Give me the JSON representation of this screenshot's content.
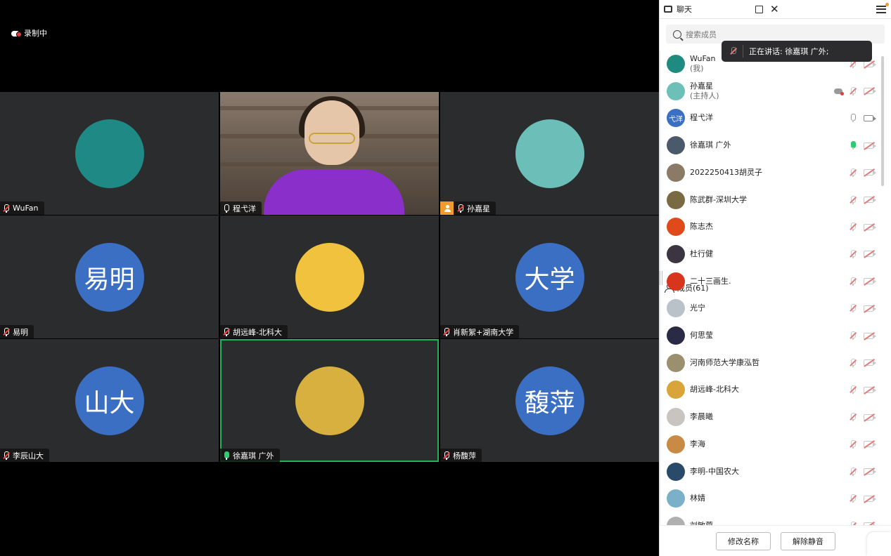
{
  "recording": {
    "label": "录制中"
  },
  "tiles": [
    {
      "name": "WuFan",
      "type": "image",
      "mic": "muted",
      "host": false
    },
    {
      "name": "程弋洋",
      "type": "video",
      "mic": "on",
      "host": false
    },
    {
      "name": "孙嘉星",
      "type": "image",
      "mic": "muted",
      "host": true
    },
    {
      "name": "易明",
      "type": "text",
      "avatar_text": "易明",
      "mic": "muted",
      "host": false
    },
    {
      "name": "胡远峰-北科大",
      "type": "image",
      "mic": "muted",
      "host": false
    },
    {
      "name": "肖新絮+湖南大学",
      "type": "text",
      "avatar_text": "大学",
      "mic": "muted",
      "host": false
    },
    {
      "name": "李辰山大",
      "type": "text",
      "avatar_text": "山大",
      "mic": "muted",
      "host": false
    },
    {
      "name": "徐嘉琪 广外",
      "type": "image",
      "mic": "speaking",
      "host": false,
      "speaking": true
    },
    {
      "name": "杨馥萍",
      "type": "text",
      "avatar_text": "馥萍",
      "mic": "muted",
      "host": false
    }
  ],
  "sidebar": {
    "tab_chat": "聊天",
    "tab_members": "成员(61)",
    "search_placeholder": "搜索成员",
    "speaking_tooltip": "正在讲话:  徐嘉琪 广外;",
    "members": [
      {
        "name": "WuFan",
        "sub": "(我)",
        "avatar_color": "#1f8a7f",
        "mic": "muted",
        "cam": "off"
      },
      {
        "name": "孙嘉星",
        "sub": "(主持人)",
        "avatar_color": "#6cc0b8",
        "mic": "muted",
        "cam": "off",
        "recording": true
      },
      {
        "name": "程弋洋",
        "sub": "",
        "avatar_text": "弋洋",
        "avatar_color": "#3b6fc3",
        "mic": "on",
        "cam": "on"
      },
      {
        "name": "徐嘉琪 广外",
        "sub": "",
        "avatar_color": "#4a5a6a",
        "mic": "speaking",
        "cam": "off"
      },
      {
        "name": "2022250413胡灵子",
        "sub": "",
        "avatar_color": "#8a7a66",
        "mic": "muted",
        "cam": "off"
      },
      {
        "name": "陈武群-深圳大学",
        "sub": "",
        "avatar_color": "#7a6a44",
        "mic": "muted",
        "cam": "off"
      },
      {
        "name": "陈志杰",
        "sub": "",
        "avatar_color": "#e04a1a",
        "mic": "muted",
        "cam": "off"
      },
      {
        "name": "杜行健",
        "sub": "",
        "avatar_color": "#3a3540",
        "mic": "muted",
        "cam": "off"
      },
      {
        "name": "二十三画生.",
        "sub": "",
        "avatar_color": "#d8351d",
        "mic": "muted",
        "cam": "off"
      },
      {
        "name": "光宁",
        "sub": "",
        "avatar_color": "#b8c2c8",
        "mic": "muted",
        "cam": "off"
      },
      {
        "name": "何思莹",
        "sub": "",
        "avatar_color": "#2a2a44",
        "mic": "muted",
        "cam": "off"
      },
      {
        "name": "河南师范大学康泓哲",
        "sub": "",
        "avatar_color": "#9a9070",
        "mic": "muted",
        "cam": "off"
      },
      {
        "name": "胡远峰-北科大",
        "sub": "",
        "avatar_color": "#d9a53a",
        "mic": "muted",
        "cam": "off"
      },
      {
        "name": "李晨曦",
        "sub": "",
        "avatar_color": "#c8c4c0",
        "mic": "muted",
        "cam": "off"
      },
      {
        "name": "李海",
        "sub": "",
        "avatar_color": "#c88a44",
        "mic": "muted",
        "cam": "off"
      },
      {
        "name": "李明-中国农大",
        "sub": "",
        "avatar_color": "#2a4a6a",
        "mic": "muted",
        "cam": "off"
      },
      {
        "name": "林婧",
        "sub": "",
        "avatar_color": "#7ab0c8",
        "mic": "muted",
        "cam": "off"
      },
      {
        "name": "刘敏蓉",
        "sub": "",
        "avatar_color": "#b0b0b0",
        "mic": "muted",
        "cam": "off"
      }
    ],
    "btn_rename": "修改名称",
    "btn_unmute": "解除静音"
  }
}
